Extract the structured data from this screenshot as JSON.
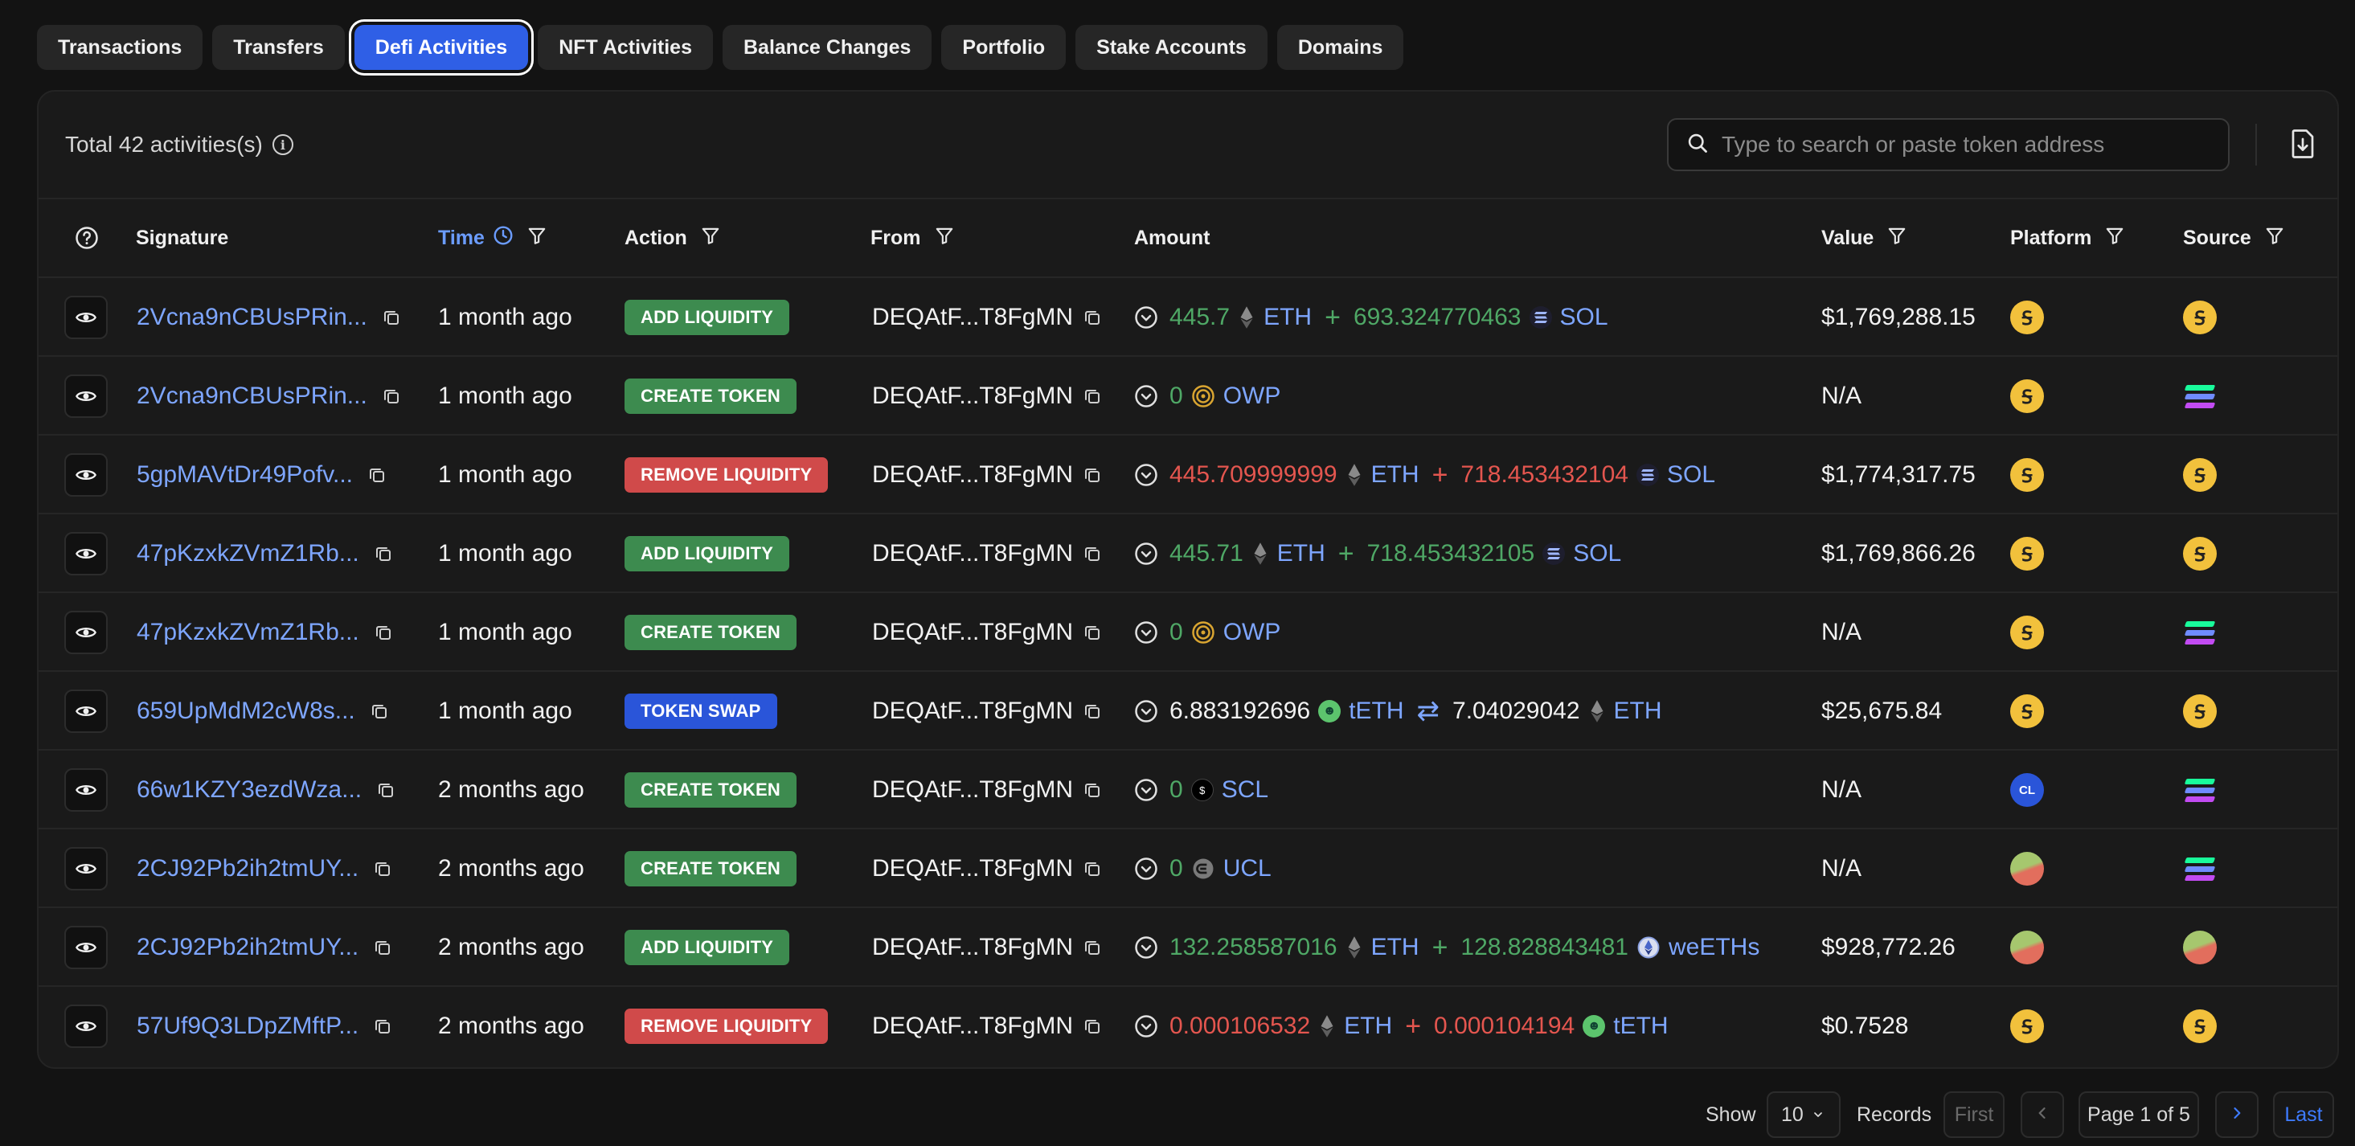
{
  "tabs": [
    {
      "label": "Transactions",
      "active": false
    },
    {
      "label": "Transfers",
      "active": false
    },
    {
      "label": "Defi Activities",
      "active": true
    },
    {
      "label": "NFT Activities",
      "active": false
    },
    {
      "label": "Balance Changes",
      "active": false
    },
    {
      "label": "Portfolio",
      "active": false
    },
    {
      "label": "Stake Accounts",
      "active": false
    },
    {
      "label": "Domains",
      "active": false
    }
  ],
  "summary": {
    "total_text": "Total 42 activities(s)"
  },
  "search": {
    "placeholder": "Type to search or paste token address"
  },
  "columns": {
    "signature": "Signature",
    "time": "Time",
    "action": "Action",
    "from": "From",
    "amount": "Amount",
    "value": "Value",
    "platform": "Platform",
    "source": "Source"
  },
  "colors": {
    "accent": "#2f5fe6",
    "link": "#7ea6ff",
    "badge_green": "#3d8b4f",
    "badge_red": "#d04a4a",
    "badge_blue": "#2a55d9",
    "amount_green": "#4fa866",
    "amount_red": "#e4564f"
  },
  "rows": [
    {
      "signature": "2Vcna9nCBUsPRin...",
      "time": "1 month ago",
      "action": "ADD LIQUIDITY",
      "action_color": "green",
      "from": "DEQAtF...T8FgMN",
      "amount": {
        "color": "green",
        "a1": "445.7",
        "t1": "ETH",
        "t1_icon": "eth-icon",
        "op": "+",
        "a2": "693.324770463",
        "t2": "SOL",
        "t2_icon": "sol-icon"
      },
      "value": "$1,769,288.15",
      "platform": "d-platform-icon",
      "source": "d-platform-icon"
    },
    {
      "signature": "2Vcna9nCBUsPRin...",
      "time": "1 month ago",
      "action": "CREATE TOKEN",
      "action_color": "green",
      "from": "DEQAtF...T8FgMN",
      "amount": {
        "color": "green",
        "a1": "0",
        "t1": "OWP",
        "t1_icon": "owp-icon"
      },
      "value": "N/A",
      "platform": "d-platform-icon",
      "source": "solana-icon"
    },
    {
      "signature": "5gpMAVtDr49Pofv...",
      "time": "1 month ago",
      "action": "REMOVE LIQUIDITY",
      "action_color": "red",
      "from": "DEQAtF...T8FgMN",
      "amount": {
        "color": "red",
        "a1": "445.709999999",
        "t1": "ETH",
        "t1_icon": "eth-icon",
        "op": "+",
        "a2": "718.453432104",
        "t2": "SOL",
        "t2_icon": "sol-icon"
      },
      "value": "$1,774,317.75",
      "platform": "d-platform-icon",
      "source": "d-platform-icon"
    },
    {
      "signature": "47pKzxkZVmZ1Rb...",
      "time": "1 month ago",
      "action": "ADD LIQUIDITY",
      "action_color": "green",
      "from": "DEQAtF...T8FgMN",
      "amount": {
        "color": "green",
        "a1": "445.71",
        "t1": "ETH",
        "t1_icon": "eth-icon",
        "op": "+",
        "a2": "718.453432105",
        "t2": "SOL",
        "t2_icon": "sol-icon"
      },
      "value": "$1,769,866.26",
      "platform": "d-platform-icon",
      "source": "d-platform-icon"
    },
    {
      "signature": "47pKzxkZVmZ1Rb...",
      "time": "1 month ago",
      "action": "CREATE TOKEN",
      "action_color": "green",
      "from": "DEQAtF...T8FgMN",
      "amount": {
        "color": "green",
        "a1": "0",
        "t1": "OWP",
        "t1_icon": "owp-icon"
      },
      "value": "N/A",
      "platform": "d-platform-icon",
      "source": "solana-icon"
    },
    {
      "signature": "659UpMdM2cW8s...",
      "time": "1 month ago",
      "action": "TOKEN SWAP",
      "action_color": "blue",
      "from": "DEQAtF...T8FgMN",
      "amount": {
        "color": "white",
        "a1": "6.883192696",
        "t1": "tETH",
        "t1_icon": "teth-icon",
        "op": "⇄",
        "a2": "7.04029042",
        "t2": "ETH",
        "t2_icon": "eth-icon"
      },
      "value": "$25,675.84",
      "platform": "d-platform-icon",
      "source": "d-platform-icon"
    },
    {
      "signature": "66w1KZY3ezdWza...",
      "time": "2 months ago",
      "action": "CREATE TOKEN",
      "action_color": "green",
      "from": "DEQAtF...T8FgMN",
      "amount": {
        "color": "green",
        "a1": "0",
        "t1": "SCL",
        "t1_icon": "scl-icon"
      },
      "value": "N/A",
      "platform": "cl-platform-icon",
      "platform_text": "CL",
      "source": "solana-icon"
    },
    {
      "signature": "2CJ92Pb2ih2tmUY...",
      "time": "2 months ago",
      "action": "CREATE TOKEN",
      "action_color": "green",
      "from": "DEQAtF...T8FgMN",
      "amount": {
        "color": "green",
        "a1": "0",
        "t1": "UCL",
        "t1_icon": "ucl-icon"
      },
      "value": "N/A",
      "platform": "p-platform-icon",
      "source": "solana-icon"
    },
    {
      "signature": "2CJ92Pb2ih2tmUY...",
      "time": "2 months ago",
      "action": "ADD LIQUIDITY",
      "action_color": "green",
      "from": "DEQAtF...T8FgMN",
      "amount": {
        "color": "green",
        "a1": "132.258587016",
        "t1": "ETH",
        "t1_icon": "eth-icon",
        "op": "+",
        "a2": "128.828843481",
        "t2": "weETHs",
        "t2_icon": "weeths-icon"
      },
      "value": "$928,772.26",
      "platform": "p-platform-icon",
      "source": "p-platform-icon"
    },
    {
      "signature": "57Uf9Q3LDpZMftP...",
      "time": "2 months ago",
      "action": "REMOVE LIQUIDITY",
      "action_color": "red",
      "from": "DEQAtF...T8FgMN",
      "amount": {
        "color": "red",
        "a1": "0.000106532",
        "t1": "ETH",
        "t1_icon": "eth-icon",
        "op": "+",
        "a2": "0.000104194",
        "t2": "tETH",
        "t2_icon": "teth-icon"
      },
      "value": "$0.7528",
      "platform": "d-platform-icon",
      "source": "d-platform-icon"
    }
  ],
  "footer": {
    "show_label": "Show",
    "page_size": "10",
    "records_label": "Records",
    "first_label": "First",
    "page_label": "Page 1 of 5",
    "last_label": "Last"
  }
}
